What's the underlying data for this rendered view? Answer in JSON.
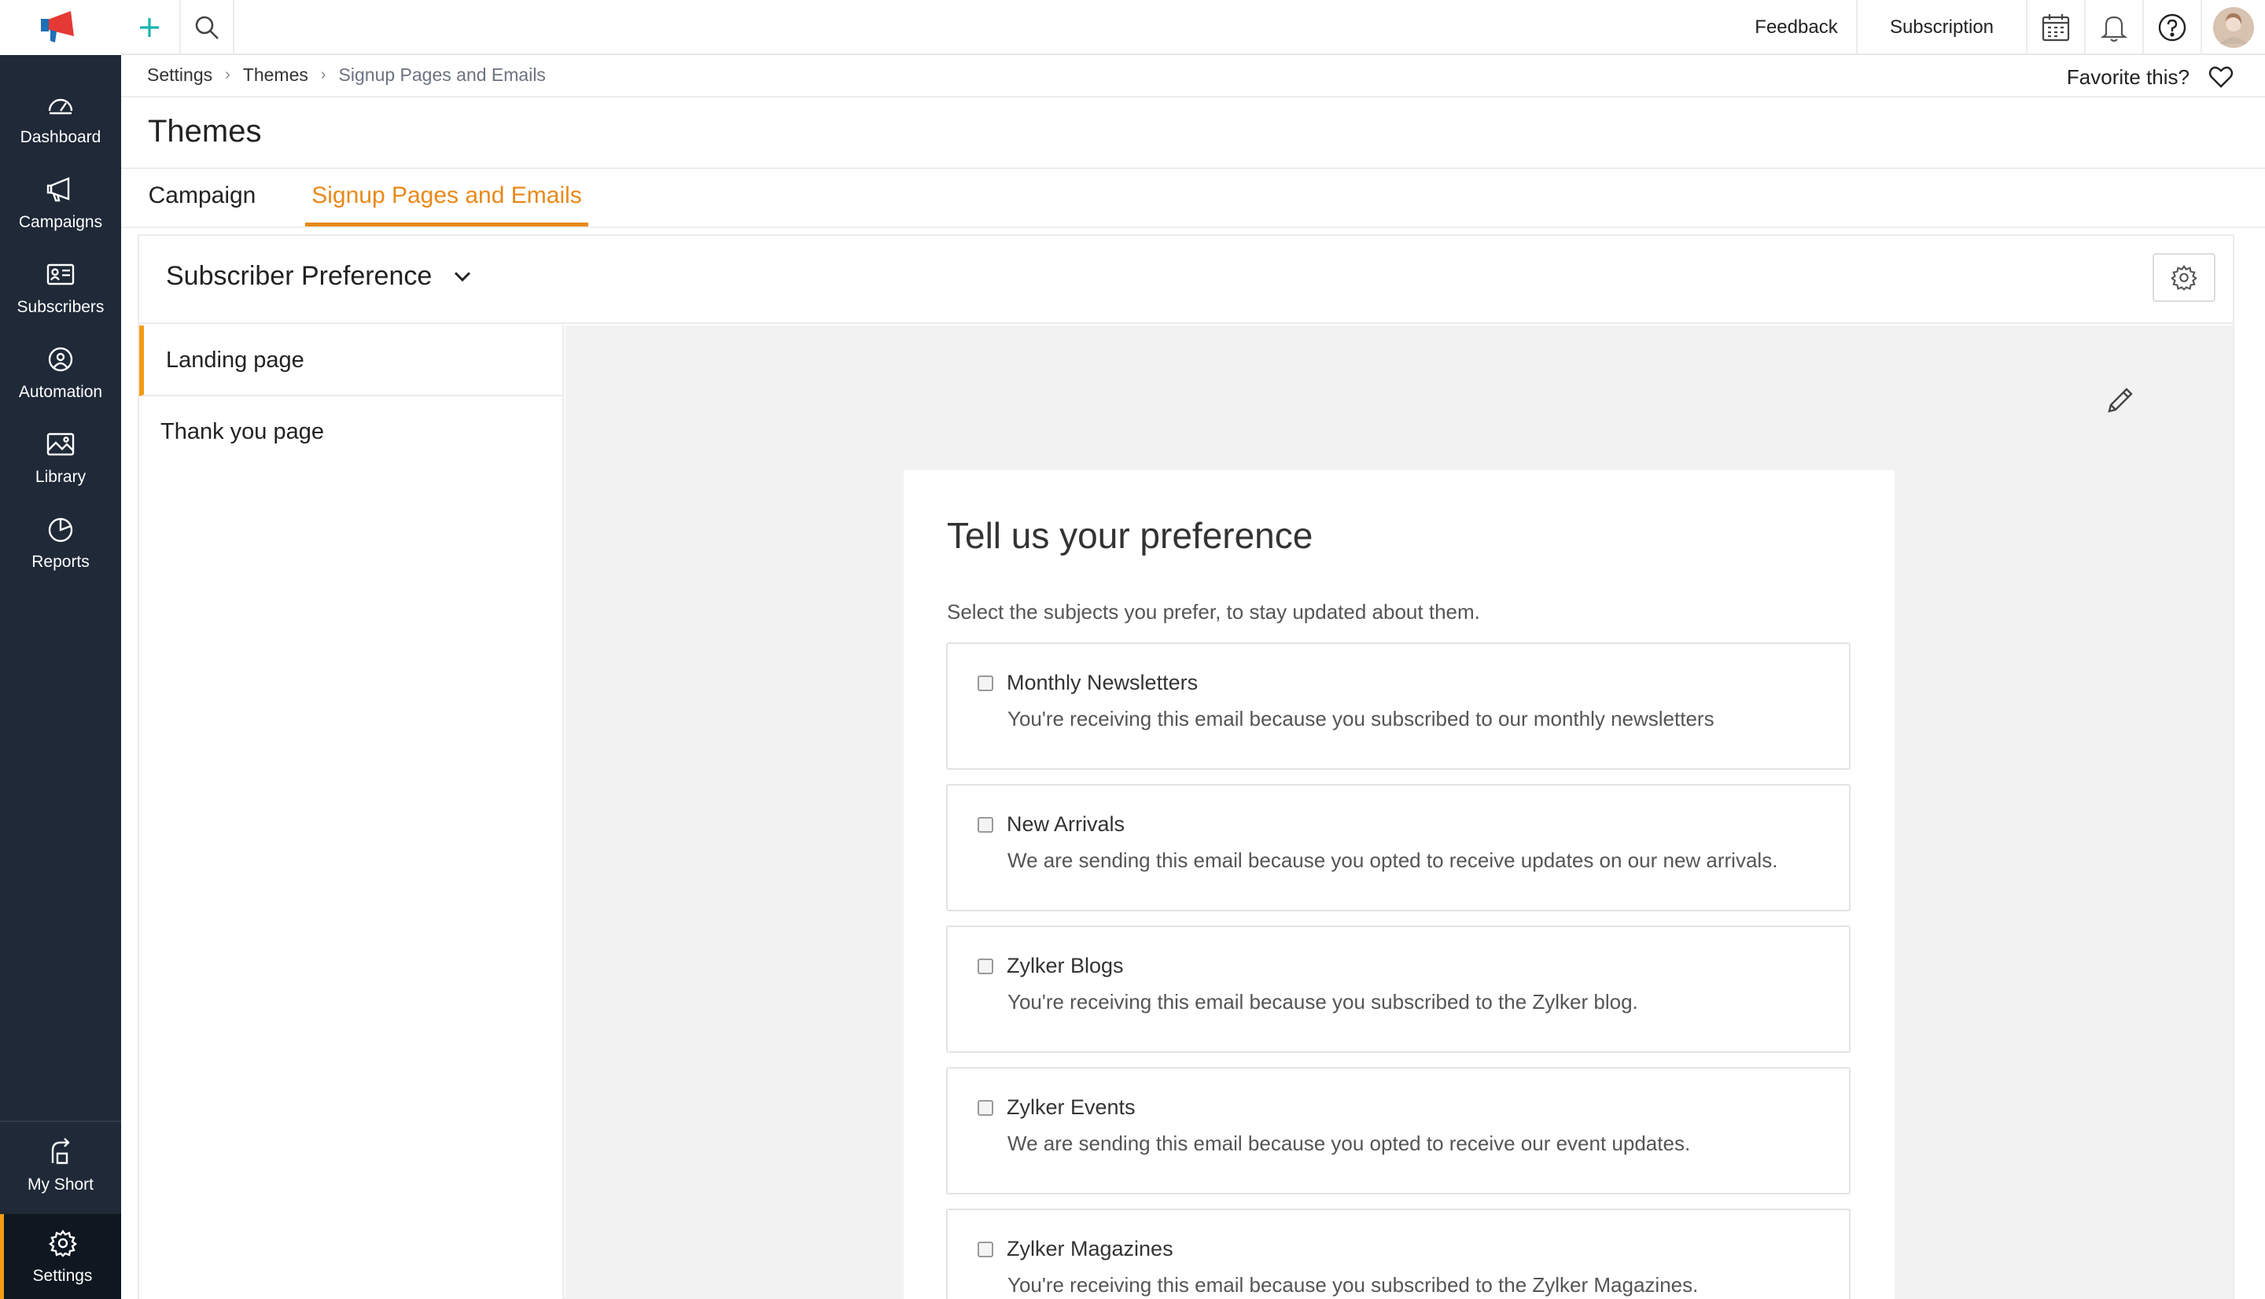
{
  "topbar": {
    "feedback": "Feedback",
    "subscription": "Subscription"
  },
  "sidebar": {
    "items": [
      {
        "label": "Dashboard",
        "icon": "dashboard-icon"
      },
      {
        "label": "Campaigns",
        "icon": "megaphone-icon"
      },
      {
        "label": "Subscribers",
        "icon": "contact-card-icon"
      },
      {
        "label": "Automation",
        "icon": "automation-icon"
      },
      {
        "label": "Library",
        "icon": "image-icon"
      },
      {
        "label": "Reports",
        "icon": "pie-chart-icon"
      }
    ],
    "bottom": [
      {
        "label": "My Short",
        "icon": "shortcut-icon"
      },
      {
        "label": "Settings",
        "icon": "gear-icon",
        "active": true
      }
    ]
  },
  "breadcrumb": {
    "items": [
      "Settings",
      "Themes",
      "Signup Pages and Emails"
    ]
  },
  "favorite": {
    "label": "Favorite this?"
  },
  "page": {
    "title": "Themes"
  },
  "tabs": [
    {
      "label": "Campaign",
      "active": false
    },
    {
      "label": "Signup Pages and Emails",
      "active": true
    }
  ],
  "panel": {
    "dropdown_label": "Subscriber Preference",
    "pages": [
      {
        "label": "Landing page",
        "active": true
      },
      {
        "label": "Thank you page",
        "active": false
      }
    ]
  },
  "preference_form": {
    "title": "Tell us your preference",
    "subtitle": "Select the subjects you prefer, to stay updated about them.",
    "options": [
      {
        "title": "Monthly Newsletters",
        "description": "You're receiving this email because you subscribed to our monthly newsletters",
        "checked": false
      },
      {
        "title": "New Arrivals",
        "description": "We are sending this email because you opted to receive updates on our new arrivals.",
        "checked": false
      },
      {
        "title": "Zylker Blogs",
        "description": "You're receiving this email because you subscribed to the Zylker blog.",
        "checked": false
      },
      {
        "title": "Zylker Events",
        "description": "We are sending this email because you opted to receive our event updates.",
        "checked": false
      },
      {
        "title": "Zylker Magazines",
        "description": "You're receiving this email because you subscribed to the Zylker Magazines.",
        "checked": false
      }
    ]
  },
  "colors": {
    "accent": "#e8891a",
    "sidebar_bg": "#1f2937",
    "add_plus": "#19b5b0",
    "logo_red": "#e53935"
  }
}
